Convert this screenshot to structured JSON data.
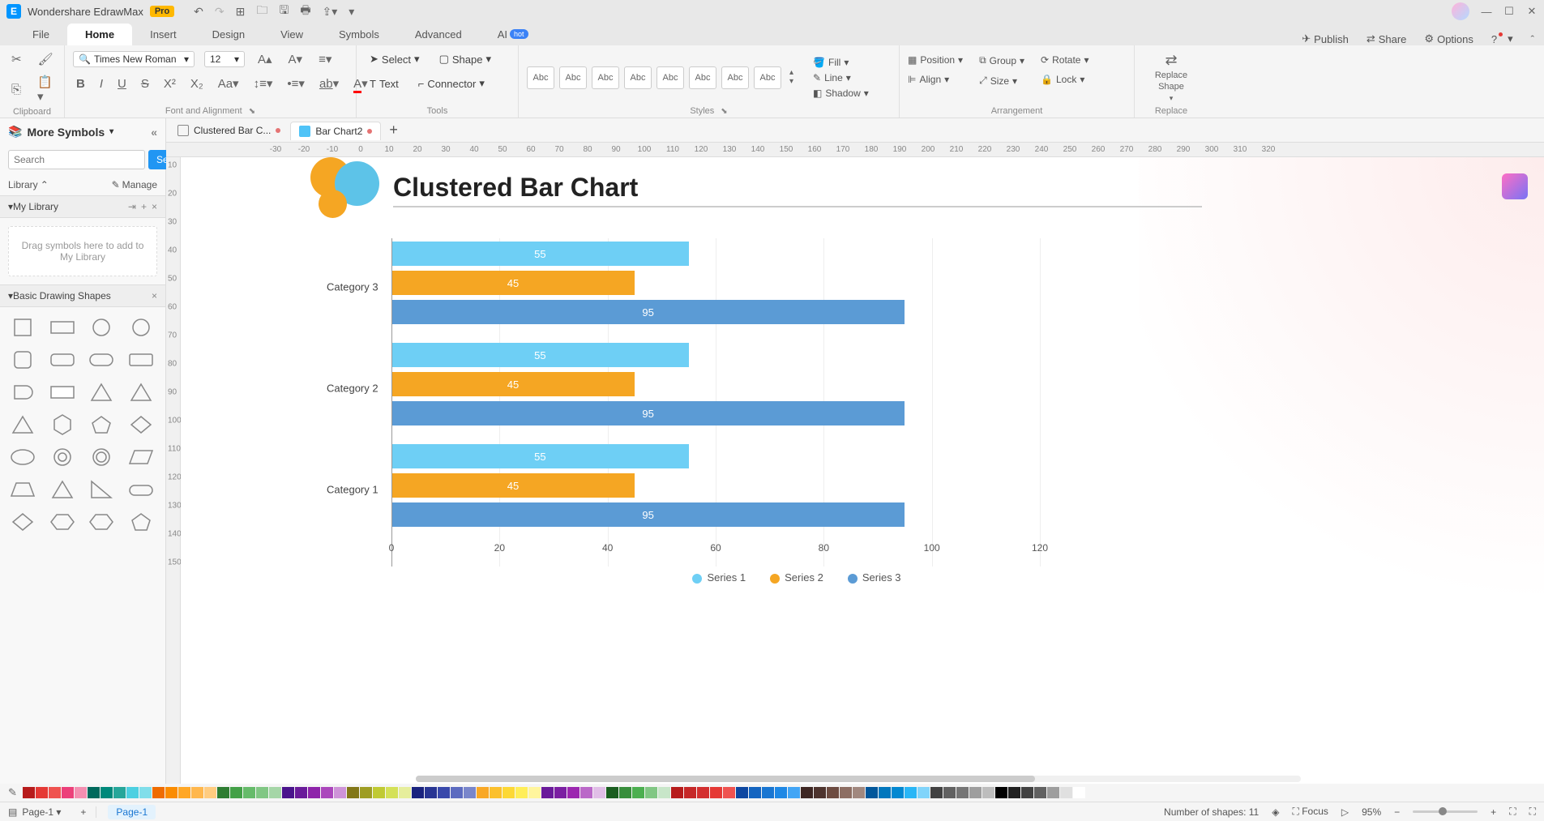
{
  "app": {
    "title": "Wondershare EdrawMax",
    "badge": "Pro"
  },
  "menu": {
    "tabs": [
      "File",
      "Home",
      "Insert",
      "Design",
      "View",
      "Symbols",
      "Advanced",
      "AI"
    ],
    "active": "Home",
    "hot_badge": "hot",
    "right": {
      "publish": "Publish",
      "share": "Share",
      "options": "Options"
    }
  },
  "ribbon": {
    "clipboard_label": "Clipboard",
    "font_label": "Font and Alignment",
    "tools_label": "Tools",
    "styles_label": "Styles",
    "arrangement_label": "Arrangement",
    "replace_label": "Replace",
    "font_name": "Times New Roman",
    "font_size": "12",
    "select": "Select",
    "shape": "Shape",
    "text": "Text",
    "connector": "Connector",
    "style_preview": "Abc",
    "fill": "Fill",
    "line": "Line",
    "shadow": "Shadow",
    "position": "Position",
    "align": "Align",
    "group": "Group",
    "size": "Size",
    "rotate": "Rotate",
    "lock": "Lock",
    "replace_shape": "Replace\nShape"
  },
  "sidebar": {
    "title": "More Symbols",
    "search_placeholder": "Search",
    "search_btn": "Search",
    "library": "Library",
    "manage": "Manage",
    "my_library": "My Library",
    "dropzone": "Drag symbols here to add to My Library",
    "basic_shapes": "Basic Drawing Shapes"
  },
  "docs": {
    "tabs": [
      {
        "label": "Clustered Bar C...",
        "active": false,
        "modified": true
      },
      {
        "label": "Bar Chart2",
        "active": true,
        "modified": true
      }
    ]
  },
  "chart_data": {
    "type": "bar",
    "orientation": "horizontal",
    "title": "Clustered Bar Chart",
    "categories": [
      "Category 3",
      "Category 2",
      "Category 1"
    ],
    "series": [
      {
        "name": "Series 1",
        "color": "#6ecff5",
        "values": [
          55,
          55,
          55
        ]
      },
      {
        "name": "Series 2",
        "color": "#f5a623",
        "values": [
          45,
          45,
          45
        ]
      },
      {
        "name": "Series 3",
        "color": "#5b9bd5",
        "values": [
          95,
          95,
          95
        ]
      }
    ],
    "xlim": [
      0,
      120
    ],
    "x_ticks": [
      0,
      20,
      40,
      60,
      80,
      100,
      120
    ]
  },
  "ruler_h_ticks": [
    -30,
    -20,
    -10,
    0,
    10,
    20,
    30,
    40,
    50,
    60,
    70,
    80,
    90,
    100,
    110,
    120,
    130,
    140,
    150,
    160,
    170,
    180,
    190,
    200,
    210,
    220,
    230,
    240,
    250,
    260,
    270,
    280,
    290,
    300,
    310,
    320
  ],
  "ruler_v_ticks": [
    10,
    20,
    30,
    40,
    50,
    60,
    70,
    80,
    90,
    100,
    110,
    120,
    130,
    140,
    150
  ],
  "status": {
    "page_sel": "Page-1",
    "page_tab": "Page-1",
    "shapes_count": "Number of shapes: 11",
    "focus": "Focus",
    "zoom": "95%"
  },
  "colors": [
    "#b71c1c",
    "#e53935",
    "#ef5350",
    "#ec407a",
    "#f48fb1",
    "#00695c",
    "#00897b",
    "#26a69a",
    "#4dd0e1",
    "#80deea",
    "#ef6c00",
    "#fb8c00",
    "#ffa726",
    "#ffb74d",
    "#ffcc80",
    "#2e7d32",
    "#43a047",
    "#66bb6a",
    "#81c784",
    "#a5d6a7",
    "#4a148c",
    "#6a1b9a",
    "#8e24aa",
    "#ab47bc",
    "#ce93d8",
    "#827717",
    "#9e9d24",
    "#c0ca33",
    "#d4e157",
    "#e6ee9c",
    "#1a237e",
    "#283593",
    "#3949ab",
    "#5c6bc0",
    "#7986cb",
    "#f9a825",
    "#fbc02d",
    "#fdd835",
    "#ffee58",
    "#fff59d",
    "#6a1b9a",
    "#7b1fa2",
    "#9c27b0",
    "#ba68c8",
    "#e1bee7",
    "#1b5e20",
    "#388e3c",
    "#4caf50",
    "#81c784",
    "#c8e6c9",
    "#b71c1c",
    "#c62828",
    "#d32f2f",
    "#e53935",
    "#ef5350",
    "#0d47a1",
    "#1565c0",
    "#1976d2",
    "#1e88e5",
    "#42a5f5",
    "#3e2723",
    "#4e342e",
    "#6d4c41",
    "#8d6e63",
    "#a1887f",
    "#01579b",
    "#0277bd",
    "#0288d1",
    "#29b6f6",
    "#81d4fa",
    "#424242",
    "#616161",
    "#757575",
    "#9e9e9e",
    "#bdbdbd",
    "#000000",
    "#212121",
    "#424242",
    "#616161",
    "#9e9e9e",
    "#e0e0e0",
    "#ffffff"
  ]
}
